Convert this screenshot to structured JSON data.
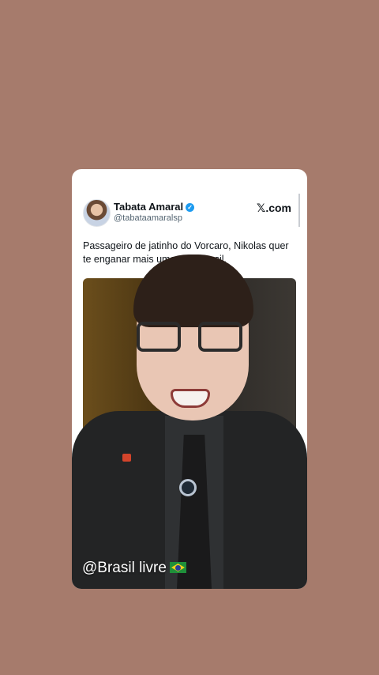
{
  "post": {
    "name": "Tabata Amaral",
    "handle": "@tabataamaralsp",
    "brand": "com",
    "text": "Passageiro de jatinho do Vorcaro, Nikolas quer te enganar mais uma vez, Brasil."
  },
  "caption": "@Brasil livre",
  "colors": {
    "background": "#a67b6c",
    "card": "#ffffff",
    "verified": "#1d9bf0"
  },
  "icons": [
    "verified-badge-icon",
    "x-logo-icon",
    "brazil-flag-icon"
  ]
}
